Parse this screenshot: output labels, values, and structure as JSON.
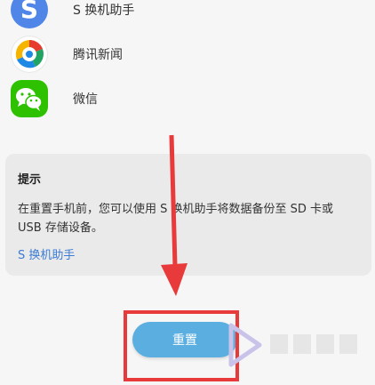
{
  "apps": [
    {
      "label": "S 换机助手",
      "icon": "s-switch-icon"
    },
    {
      "label": "腾讯新闻",
      "icon": "tencent-news-icon"
    },
    {
      "label": "微信",
      "icon": "wechat-icon"
    }
  ],
  "tip": {
    "title": "提示",
    "body": "在重置手机前，您可以使用 S 换机助手将数据备份至 SD 卡或 USB 存储设备。",
    "link": "S 换机助手"
  },
  "reset_button": {
    "label": "重置"
  },
  "colors": {
    "accent": "#5aaee0",
    "link": "#3a7bd5",
    "annotation": "#e83a3a",
    "wechat": "#2dc100"
  }
}
